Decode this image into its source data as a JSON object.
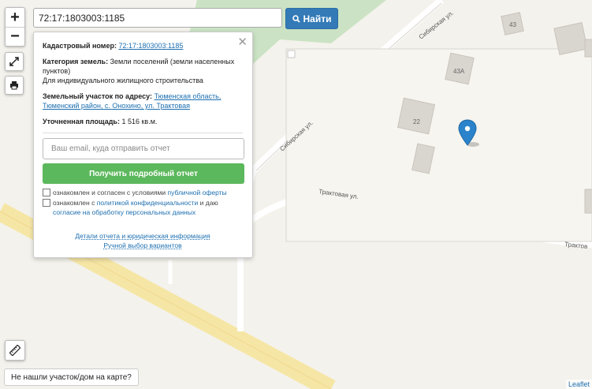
{
  "search": {
    "value": "72:17:1803003:1185",
    "button_label": "Найти"
  },
  "zoom": {
    "in": "+",
    "out": "−"
  },
  "popup": {
    "cadastral_label": "Кадастровый номер:",
    "cadastral_value": "72:17:1803003:1185",
    "category_label": "Категория земель:",
    "category_value": "Земли поселений (земли населенных пунктов)",
    "use_value": "Для индивидуального жилищного строительства",
    "address_label": "Земельный участок по адресу:",
    "address_value": "Тюменская область, Тюменский район, с. Онохино, ул. Трактовая",
    "area_label": "Уточненная площадь:",
    "area_value": "1 516 кв.м.",
    "email_placeholder": "Ваш email, куда отправить отчет",
    "report_button": "Получить подробный отчет",
    "check1_text": "ознакомлен и согласен с условиями",
    "check1_link": "публичной оферты",
    "check2_text": "ознакомлен с",
    "check2_link1": "политикой конфиденциальности",
    "check2_mid": "и даю",
    "check2_link2": "согласие на обработку персональных данных",
    "details_link": "Детали отчета и юридическая информация",
    "manual_link": "Ручной выбор вариантов"
  },
  "map": {
    "street1": "Сибирская ул.",
    "street2": "Сибирская ул.",
    "street3": "Трактовая ул.",
    "street4": "Трактов",
    "house1": "43",
    "house2": "43А",
    "house3": "22"
  },
  "not_found": "Не нашли участок/дом на карте?",
  "attribution": "Leaflet"
}
